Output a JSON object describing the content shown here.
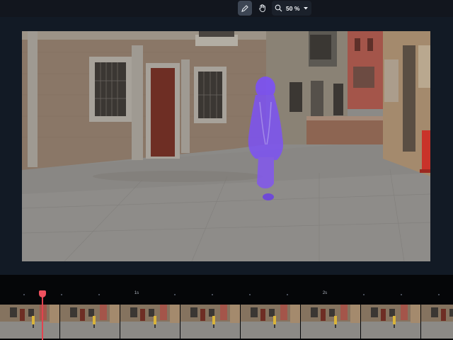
{
  "toolbar": {
    "pen_tool_icon": "pen-icon",
    "hand_tool_icon": "hand-icon",
    "zoom_icon": "magnifier-icon",
    "zoom_level": "50 %",
    "active_tool": "pen"
  },
  "colors": {
    "background": "#0c1118",
    "stage": "#121a25",
    "mask_overlay": "#7a4dff",
    "playhead": "#e2434f",
    "timeline": "#050608"
  },
  "viewer": {
    "image_description_icon": "video-frame",
    "mask_present": true
  },
  "timeline": {
    "time_labels": [
      "1s",
      "2s"
    ],
    "thumbnail_count": 8,
    "playhead_icon": "playhead-marker"
  }
}
